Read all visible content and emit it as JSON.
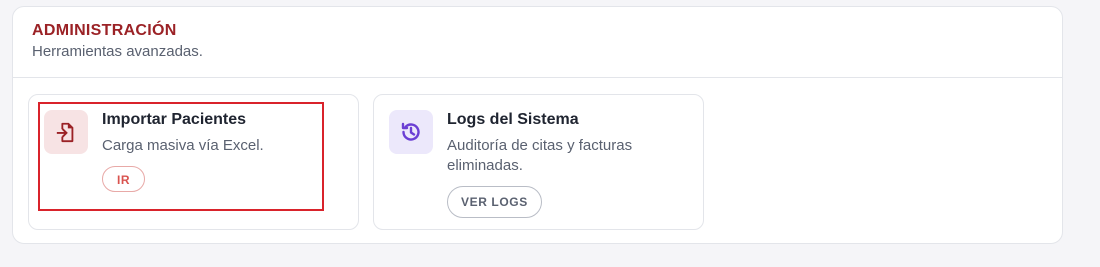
{
  "section": {
    "title": "ADMINISTRACIÓN",
    "subtitle": "Herramientas avanzadas."
  },
  "cards": [
    {
      "title": "Importar Pacientes",
      "description": "Carga masiva vía Excel.",
      "button_label": "IR",
      "icon": "file-import-icon",
      "accent": "#9b2226"
    },
    {
      "title": "Logs del Sistema",
      "description": "Auditoría de citas y facturas eliminadas.",
      "button_label": "VER LOGS",
      "icon": "history-icon",
      "accent": "#6b3fd4"
    }
  ],
  "colors": {
    "section_title": "#9b2226",
    "highlight_border": "#d9232b"
  }
}
